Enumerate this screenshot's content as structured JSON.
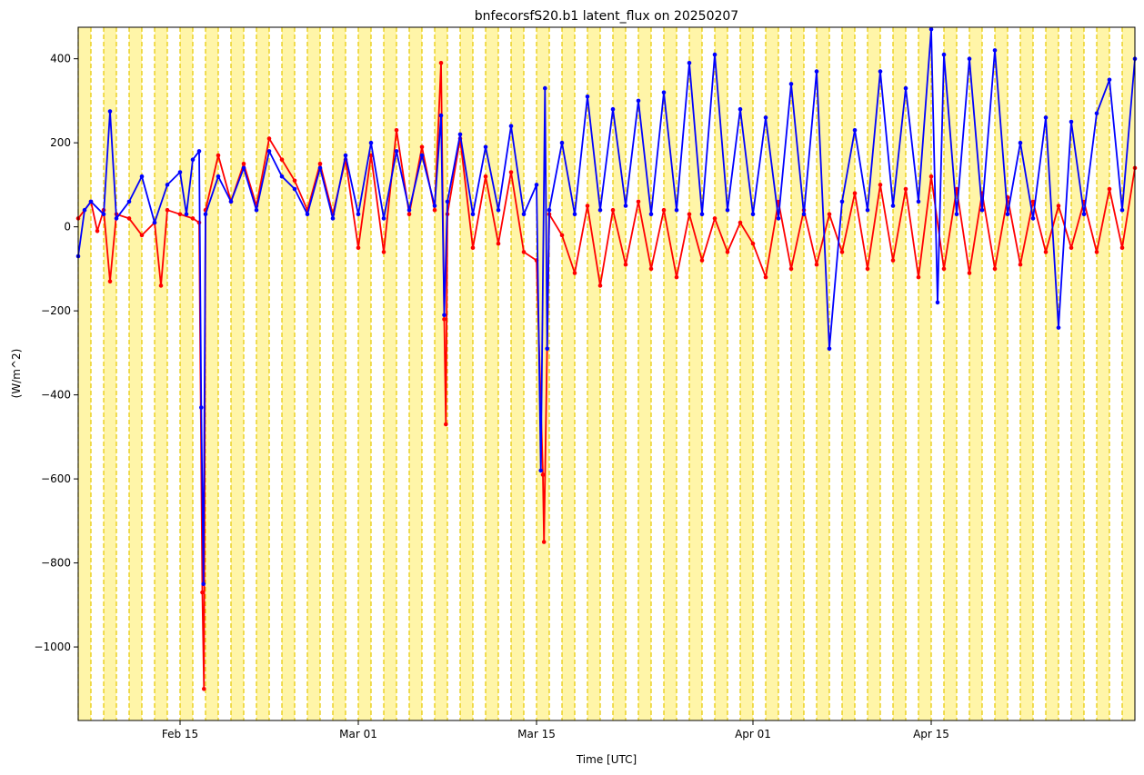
{
  "chart_data": {
    "type": "line",
    "title": "bnfecorsfS20.b1 latent_flux on 20250207",
    "xlabel": "Time [UTC]",
    "ylabel": "(W/m^2)",
    "x_range": [
      "2025-02-07",
      "2025-05-01"
    ],
    "ylim": [
      -1175,
      475
    ],
    "x_ticks": [
      {
        "date": "2025-02-15",
        "label": "Feb 15"
      },
      {
        "date": "2025-03-01",
        "label": "Mar 01"
      },
      {
        "date": "2025-03-15",
        "label": "Mar 15"
      },
      {
        "date": "2025-04-01",
        "label": "Apr 01"
      },
      {
        "date": "2025-04-15",
        "label": "Apr 15"
      }
    ],
    "y_ticks": [
      -1000,
      -800,
      -600,
      -400,
      -200,
      0,
      200,
      400
    ],
    "y_tick_labels": [
      "−1000",
      "−800",
      "−600",
      "−400",
      "−200",
      "0",
      "200",
      "400"
    ],
    "grid": false,
    "background_bands": {
      "color": "#fff5a8",
      "line_color": "#e6c800",
      "period_days": 1,
      "dashed_lines": true
    },
    "series": [
      {
        "color": "#ff0000",
        "points": [
          [
            "2025-02-07",
            20
          ],
          [
            "2025-02-08",
            60
          ],
          [
            "2025-02-08T12",
            -10
          ],
          [
            "2025-02-09",
            40
          ],
          [
            "2025-02-09T12",
            -130
          ],
          [
            "2025-02-10",
            30
          ],
          [
            "2025-02-11",
            20
          ],
          [
            "2025-02-12",
            -20
          ],
          [
            "2025-02-13",
            10
          ],
          [
            "2025-02-13T12",
            -140
          ],
          [
            "2025-02-14",
            40
          ],
          [
            "2025-02-15",
            30
          ],
          [
            "2025-02-16",
            20
          ],
          [
            "2025-02-16T12",
            10
          ],
          [
            "2025-02-16T18",
            -870
          ],
          [
            "2025-02-16T21",
            -1100
          ],
          [
            "2025-02-17",
            40
          ],
          [
            "2025-02-18",
            170
          ],
          [
            "2025-02-19",
            60
          ],
          [
            "2025-02-20",
            150
          ],
          [
            "2025-02-21",
            50
          ],
          [
            "2025-02-22",
            210
          ],
          [
            "2025-02-23",
            160
          ],
          [
            "2025-02-24",
            110
          ],
          [
            "2025-02-25",
            40
          ],
          [
            "2025-02-26",
            150
          ],
          [
            "2025-02-27",
            30
          ],
          [
            "2025-02-28",
            160
          ],
          [
            "2025-03-01",
            -50
          ],
          [
            "2025-03-02",
            170
          ],
          [
            "2025-03-03",
            -60
          ],
          [
            "2025-03-04",
            230
          ],
          [
            "2025-03-05",
            30
          ],
          [
            "2025-03-06",
            190
          ],
          [
            "2025-03-07",
            40
          ],
          [
            "2025-03-07T12",
            390
          ],
          [
            "2025-03-07T18",
            -220
          ],
          [
            "2025-03-07T21",
            -470
          ],
          [
            "2025-03-08",
            30
          ],
          [
            "2025-03-09",
            210
          ],
          [
            "2025-03-10",
            -50
          ],
          [
            "2025-03-11",
            120
          ],
          [
            "2025-03-12",
            -40
          ],
          [
            "2025-03-13",
            130
          ],
          [
            "2025-03-14",
            -60
          ],
          [
            "2025-03-15",
            -80
          ],
          [
            "2025-03-15T12",
            -590
          ],
          [
            "2025-03-15T14",
            -750
          ],
          [
            "2025-03-16",
            30
          ],
          [
            "2025-03-17",
            -20
          ],
          [
            "2025-03-18",
            -110
          ],
          [
            "2025-03-19",
            50
          ],
          [
            "2025-03-20",
            -140
          ],
          [
            "2025-03-21",
            40
          ],
          [
            "2025-03-22",
            -90
          ],
          [
            "2025-03-23",
            60
          ],
          [
            "2025-03-24",
            -100
          ],
          [
            "2025-03-25",
            40
          ],
          [
            "2025-03-26",
            -120
          ],
          [
            "2025-03-27",
            30
          ],
          [
            "2025-03-28",
            -80
          ],
          [
            "2025-03-29",
            20
          ],
          [
            "2025-03-30",
            -60
          ],
          [
            "2025-03-31",
            10
          ],
          [
            "2025-04-01",
            -40
          ],
          [
            "2025-04-02",
            -120
          ],
          [
            "2025-04-03",
            60
          ],
          [
            "2025-04-04",
            -100
          ],
          [
            "2025-04-05",
            40
          ],
          [
            "2025-04-06",
            -90
          ],
          [
            "2025-04-07",
            30
          ],
          [
            "2025-04-08",
            -60
          ],
          [
            "2025-04-09",
            80
          ],
          [
            "2025-04-10",
            -100
          ],
          [
            "2025-04-11",
            100
          ],
          [
            "2025-04-12",
            -80
          ],
          [
            "2025-04-13",
            90
          ],
          [
            "2025-04-14",
            -120
          ],
          [
            "2025-04-15",
            120
          ],
          [
            "2025-04-16",
            -100
          ],
          [
            "2025-04-17",
            90
          ],
          [
            "2025-04-18",
            -110
          ],
          [
            "2025-04-19",
            80
          ],
          [
            "2025-04-20",
            -100
          ],
          [
            "2025-04-21",
            70
          ],
          [
            "2025-04-22",
            -90
          ],
          [
            "2025-04-23",
            60
          ],
          [
            "2025-04-24",
            -60
          ],
          [
            "2025-04-25",
            50
          ],
          [
            "2025-04-26",
            -50
          ],
          [
            "2025-04-27",
            60
          ],
          [
            "2025-04-28",
            -60
          ],
          [
            "2025-04-29",
            90
          ],
          [
            "2025-04-30",
            -50
          ],
          [
            "2025-05-01",
            140
          ]
        ]
      },
      {
        "color": "#0000ff",
        "points": [
          [
            "2025-02-07",
            -70
          ],
          [
            "2025-02-07T12",
            40
          ],
          [
            "2025-02-08",
            60
          ],
          [
            "2025-02-09",
            30
          ],
          [
            "2025-02-09T12",
            275
          ],
          [
            "2025-02-10",
            20
          ],
          [
            "2025-02-11",
            60
          ],
          [
            "2025-02-12",
            120
          ],
          [
            "2025-02-13",
            10
          ],
          [
            "2025-02-14",
            100
          ],
          [
            "2025-02-15",
            130
          ],
          [
            "2025-02-15T12",
            30
          ],
          [
            "2025-02-16",
            160
          ],
          [
            "2025-02-16T12",
            180
          ],
          [
            "2025-02-16T16",
            -430
          ],
          [
            "2025-02-16T20",
            -850
          ],
          [
            "2025-02-17",
            30
          ],
          [
            "2025-02-18",
            120
          ],
          [
            "2025-02-19",
            60
          ],
          [
            "2025-02-20",
            140
          ],
          [
            "2025-02-21",
            40
          ],
          [
            "2025-02-22",
            180
          ],
          [
            "2025-02-23",
            120
          ],
          [
            "2025-02-24",
            90
          ],
          [
            "2025-02-25",
            30
          ],
          [
            "2025-02-26",
            140
          ],
          [
            "2025-02-27",
            20
          ],
          [
            "2025-02-28",
            170
          ],
          [
            "2025-03-01",
            30
          ],
          [
            "2025-03-02",
            200
          ],
          [
            "2025-03-03",
            20
          ],
          [
            "2025-03-04",
            180
          ],
          [
            "2025-03-05",
            40
          ],
          [
            "2025-03-06",
            170
          ],
          [
            "2025-03-07",
            50
          ],
          [
            "2025-03-07T12",
            265
          ],
          [
            "2025-03-07T18",
            -210
          ],
          [
            "2025-03-08",
            60
          ],
          [
            "2025-03-09",
            220
          ],
          [
            "2025-03-10",
            30
          ],
          [
            "2025-03-11",
            190
          ],
          [
            "2025-03-12",
            40
          ],
          [
            "2025-03-13",
            240
          ],
          [
            "2025-03-14",
            30
          ],
          [
            "2025-03-15",
            100
          ],
          [
            "2025-03-15T08",
            -580
          ],
          [
            "2025-03-15T16",
            330
          ],
          [
            "2025-03-15T20",
            -290
          ],
          [
            "2025-03-16",
            40
          ],
          [
            "2025-03-17",
            200
          ],
          [
            "2025-03-18",
            30
          ],
          [
            "2025-03-19",
            310
          ],
          [
            "2025-03-20",
            40
          ],
          [
            "2025-03-21",
            280
          ],
          [
            "2025-03-22",
            50
          ],
          [
            "2025-03-23",
            300
          ],
          [
            "2025-03-24",
            30
          ],
          [
            "2025-03-25",
            320
          ],
          [
            "2025-03-26",
            40
          ],
          [
            "2025-03-27",
            390
          ],
          [
            "2025-03-28",
            30
          ],
          [
            "2025-03-29",
            410
          ],
          [
            "2025-03-30",
            40
          ],
          [
            "2025-03-31",
            280
          ],
          [
            "2025-04-01",
            30
          ],
          [
            "2025-04-02",
            260
          ],
          [
            "2025-04-03",
            20
          ],
          [
            "2025-04-04",
            340
          ],
          [
            "2025-04-05",
            30
          ],
          [
            "2025-04-06",
            370
          ],
          [
            "2025-04-07",
            -290
          ],
          [
            "2025-04-08",
            60
          ],
          [
            "2025-04-09",
            230
          ],
          [
            "2025-04-10",
            40
          ],
          [
            "2025-04-11",
            370
          ],
          [
            "2025-04-12",
            50
          ],
          [
            "2025-04-13",
            330
          ],
          [
            "2025-04-14",
            60
          ],
          [
            "2025-04-15",
            470
          ],
          [
            "2025-04-15T12",
            -180
          ],
          [
            "2025-04-16",
            410
          ],
          [
            "2025-04-17",
            30
          ],
          [
            "2025-04-18",
            400
          ],
          [
            "2025-04-19",
            40
          ],
          [
            "2025-04-20",
            420
          ],
          [
            "2025-04-21",
            30
          ],
          [
            "2025-04-22",
            200
          ],
          [
            "2025-04-23",
            20
          ],
          [
            "2025-04-24",
            260
          ],
          [
            "2025-04-25",
            -240
          ],
          [
            "2025-04-26",
            250
          ],
          [
            "2025-04-27",
            30
          ],
          [
            "2025-04-28",
            270
          ],
          [
            "2025-04-29",
            350
          ],
          [
            "2025-04-30",
            40
          ],
          [
            "2025-05-01",
            400
          ]
        ]
      }
    ]
  }
}
